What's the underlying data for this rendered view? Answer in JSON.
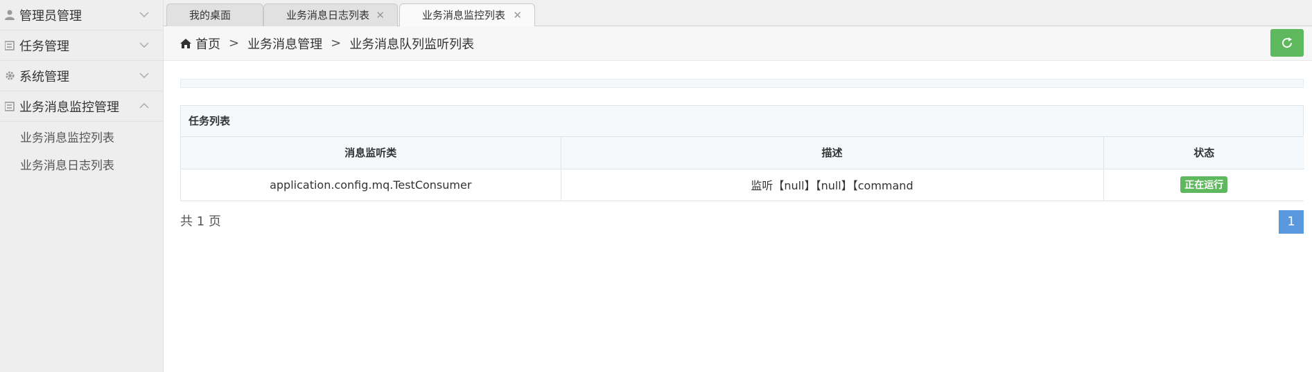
{
  "sidebar": {
    "items": [
      {
        "label": "管理员管理",
        "icon": "user-icon",
        "expanded": false
      },
      {
        "label": "任务管理",
        "icon": "list-icon",
        "expanded": false
      },
      {
        "label": "系统管理",
        "icon": "gear-icon",
        "expanded": false
      },
      {
        "label": "业务消息监控管理",
        "icon": "list-icon",
        "expanded": true
      }
    ],
    "submenu": [
      {
        "label": "业务消息监控列表"
      },
      {
        "label": "业务消息日志列表"
      }
    ]
  },
  "tabs": [
    {
      "label": "我的桌面",
      "closable": false,
      "active": false
    },
    {
      "label": "业务消息日志列表",
      "closable": true,
      "active": false
    },
    {
      "label": "业务消息监控列表",
      "closable": true,
      "active": true
    }
  ],
  "breadcrumb": {
    "home": "首页",
    "sep": ">",
    "level1": "业务消息管理",
    "level2": "业务消息队列监听列表"
  },
  "panel": {
    "title": "任务列表",
    "columns": [
      "消息监听类",
      "描述",
      "状态"
    ],
    "rows": [
      {
        "listener": "application.config.mq.TestConsumer",
        "desc": "监听【null】【null】【command",
        "status": "正在运行"
      }
    ]
  },
  "pager": {
    "info": "共 1 页",
    "current": "1"
  },
  "colors": {
    "accent_green": "#5eb95e",
    "pager_blue": "#5a98de"
  }
}
